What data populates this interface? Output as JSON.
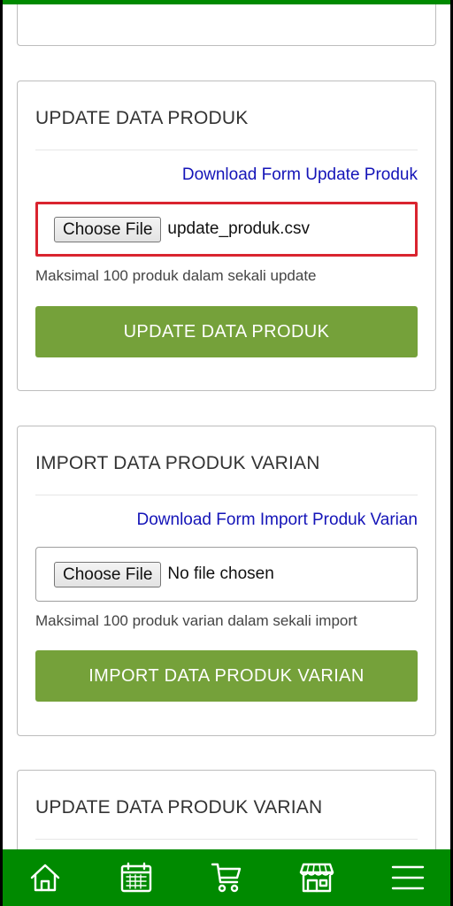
{
  "update_produk": {
    "title": "UPDATE DATA PRODUK",
    "download_link": "Download Form Update Produk",
    "choose_file_label": "Choose File",
    "file_name": "update_produk.csv",
    "hint": "Maksimal 100 produk dalam sekali update",
    "button_label": "UPDATE DATA PRODUK"
  },
  "import_varian": {
    "title": "IMPORT DATA PRODUK VARIAN",
    "download_link": "Download Form Import Produk Varian",
    "choose_file_label": "Choose File",
    "file_name": "No file chosen",
    "hint": "Maksimal 100 produk varian dalam sekali import",
    "button_label": "IMPORT DATA PRODUK VARIAN"
  },
  "update_varian": {
    "title": "UPDATE DATA PRODUK VARIAN"
  },
  "bottom_nav": {
    "items": [
      "home-icon",
      "calendar-icon",
      "cart-icon",
      "store-icon",
      "menu-icon"
    ]
  },
  "colors": {
    "nav_background": "#008a00",
    "action_button": "#75a13a",
    "link": "#1414b8",
    "highlight_border": "#d9242f"
  }
}
